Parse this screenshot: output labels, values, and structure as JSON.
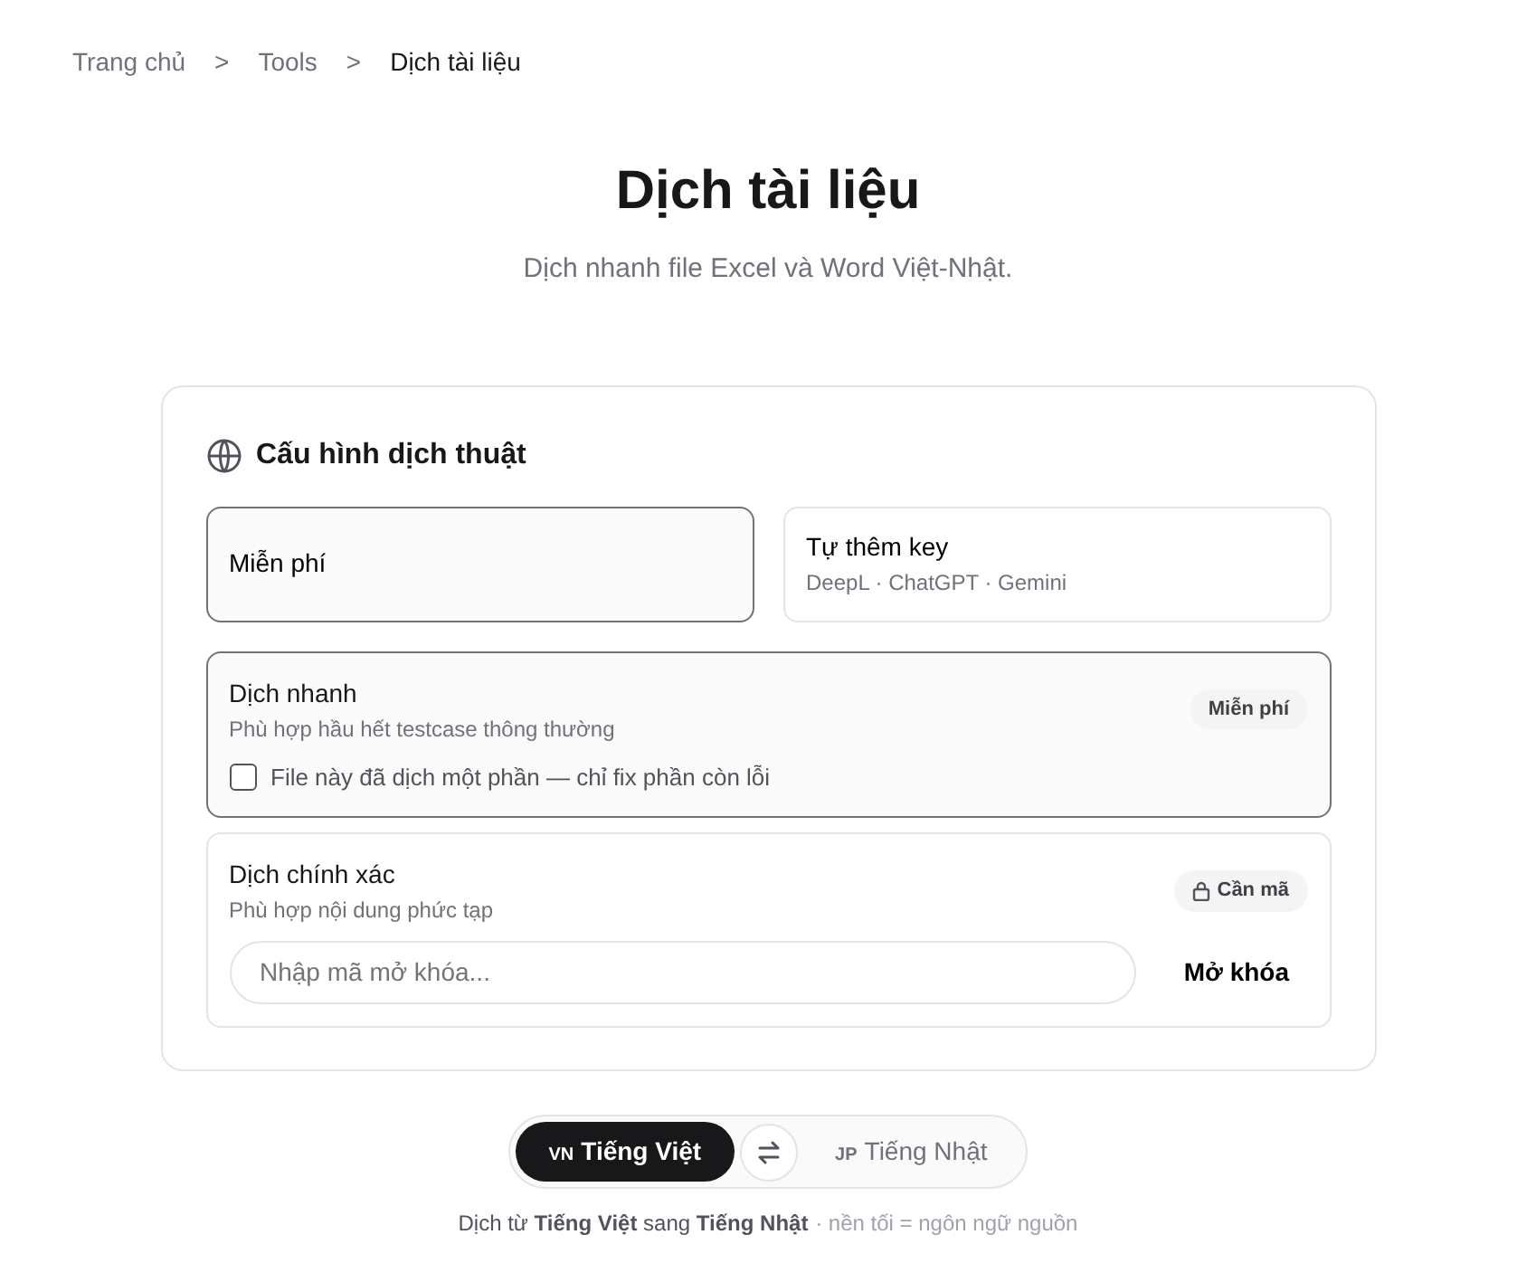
{
  "breadcrumb": [
    {
      "label": "Trang chủ",
      "current": false
    },
    {
      "label": "Tools",
      "current": false
    },
    {
      "label": "Dịch tài liệu",
      "current": true
    }
  ],
  "breadcrumb_separator": ">",
  "title": "Dịch tài liệu",
  "subtitle": "Dịch nhanh file Excel và Word Việt-Nhật.",
  "config": {
    "heading": "Cấu hình dịch thuật",
    "plans": [
      {
        "label": "Miễn phí",
        "selected": true
      },
      {
        "label": "Tự thêm key",
        "detail": "DeepL · ChatGPT · Gemini",
        "selected": false
      }
    ],
    "modes": [
      {
        "title": "Dịch nhanh",
        "description": "Phù hợp hầu hết testcase thông thường",
        "badge": "Miễn phí",
        "locked": false,
        "selected": true,
        "checkbox": {
          "label": "File này đã dịch một phần — chỉ fix phần còn lỗi",
          "checked": false
        }
      },
      {
        "title": "Dịch chính xác",
        "description": "Phù hợp nội dung phức tạp",
        "badge": "Cần mã",
        "locked": true,
        "selected": false,
        "unlock": {
          "placeholder": "Nhập mã mở khóa...",
          "button": "Mở khóa"
        }
      }
    ]
  },
  "languages": [
    {
      "code": "VN",
      "label": "Tiếng Việt",
      "selected": true
    },
    {
      "code": "JP",
      "label": "Tiếng Nhật",
      "selected": false
    }
  ],
  "note": "Dịch từ **Tiếng Việt** sang **Tiếng Nhật**",
  "hint": "· nền tối = ngôn ngữ nguồn"
}
